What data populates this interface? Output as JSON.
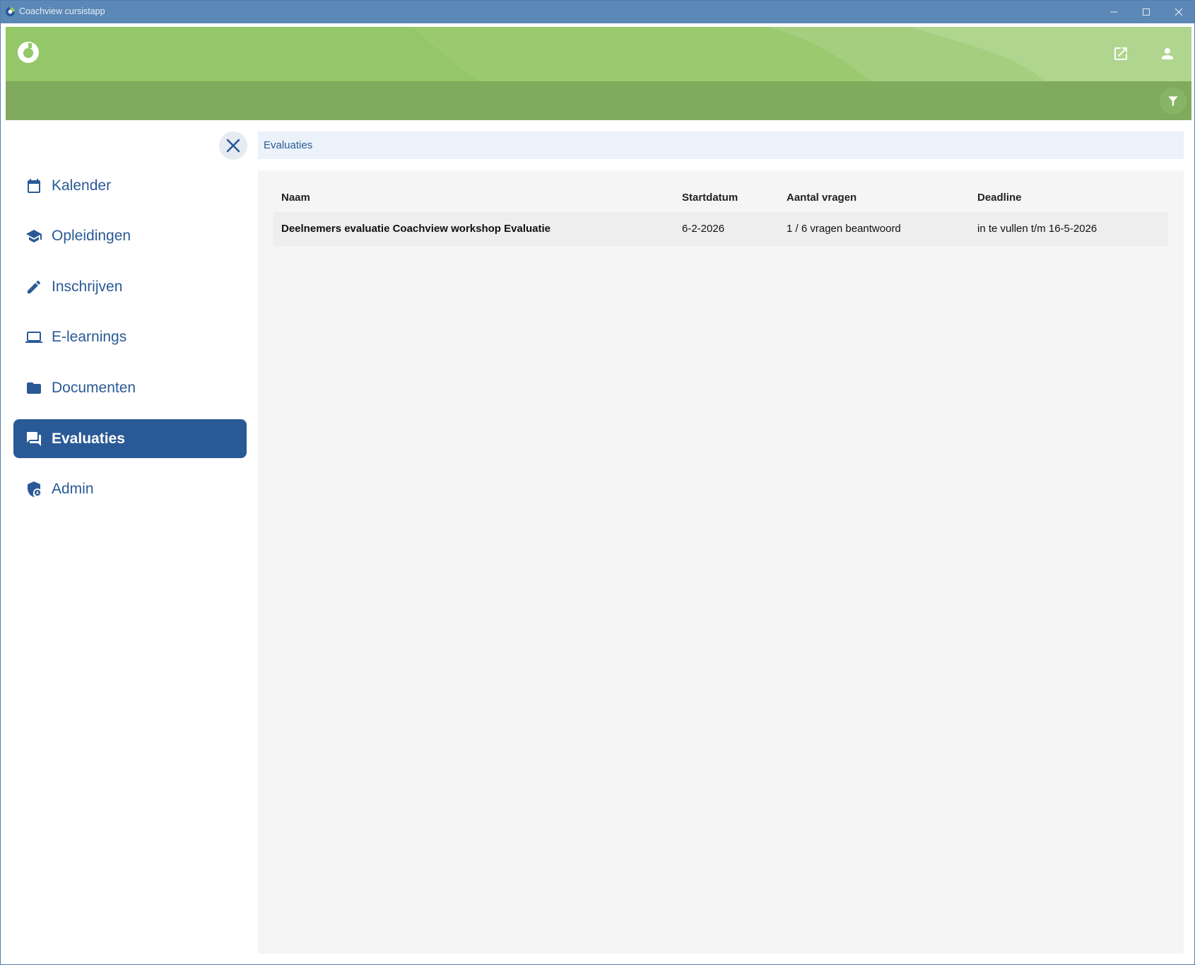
{
  "window": {
    "title": "Coachview cursistapp",
    "controls": [
      "minimize-icon",
      "maximize-icon",
      "close-icon"
    ]
  },
  "header": {
    "logo": "coachview-logo",
    "actions": [
      "open-external-icon",
      "user-icon"
    ],
    "filter_icon": "filter-icon",
    "colors": {
      "primary_green": "#93c768",
      "secondary_green": "#80ab5d"
    }
  },
  "sidebar": {
    "close_icon": "close-icon",
    "items": [
      {
        "label": "Kalender",
        "icon": "calendar-icon"
      },
      {
        "label": "Opleidingen",
        "icon": "graduation-cap-icon"
      },
      {
        "label": "Inschrijven",
        "icon": "pencil-icon"
      },
      {
        "label": "E-learnings",
        "icon": "laptop-icon"
      },
      {
        "label": "Documenten",
        "icon": "folder-icon"
      },
      {
        "label": "Evaluaties",
        "icon": "chat-icon",
        "active": true
      },
      {
        "label": "Admin",
        "icon": "shield-user-icon"
      }
    ],
    "accent_color": "#2a5a96"
  },
  "main": {
    "breadcrumb": "Evaluaties",
    "table": {
      "columns": [
        "Naam",
        "Startdatum",
        "Aantal vragen",
        "Deadline"
      ],
      "rows": [
        {
          "naam": "Deelnemers evaluatie Coachview workshop Evaluatie",
          "startdatum": "6-2-2026",
          "aantal_vragen": "1 / 6 vragen beantwoord",
          "deadline": "in te vullen t/m 16-5-2026"
        }
      ]
    }
  }
}
